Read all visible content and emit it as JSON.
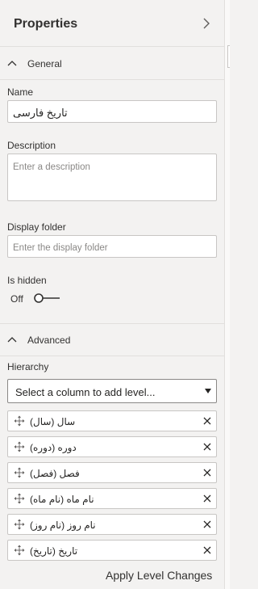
{
  "pane": {
    "title": "Properties"
  },
  "general": {
    "section_label": "General",
    "name_label": "Name",
    "name_value": "تاریخ فارسی",
    "description_label": "Description",
    "description_placeholder": "Enter a description",
    "folder_label": "Display folder",
    "folder_placeholder": "Enter the display folder",
    "hidden_label": "Is hidden",
    "hidden_state": "Off"
  },
  "advanced": {
    "section_label": "Advanced",
    "hierarchy_label": "Hierarchy",
    "select_placeholder": "Select a column to add level...",
    "levels": [
      "(سال (سال",
      "(دوره (دوره",
      "(فصل (فصل",
      "(نام ماه (نام ماه",
      "(نام روز (نام روز",
      "(تاریخ (تاریخ"
    ],
    "apply_label": "Apply Level Changes"
  },
  "colors": {
    "accent": "#323130",
    "border": "#c8c6c4",
    "background": "#f3f2f1"
  }
}
